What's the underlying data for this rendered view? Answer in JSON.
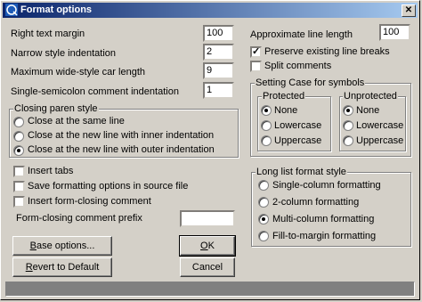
{
  "title": "Format options",
  "fields": {
    "right_text_margin": {
      "label": "Right text margin",
      "value": "100"
    },
    "narrow_indent": {
      "label": "Narrow style indentation",
      "value": "2"
    },
    "max_wide_car": {
      "label": "Maximum wide-style car length",
      "value": "9"
    },
    "semicolon_indent": {
      "label": "Single-semicolon comment indentation",
      "value": "1"
    },
    "approx_line_length": {
      "label": "Approximate line length",
      "value": "100"
    },
    "form_closing_prefix": {
      "label": "Form-closing comment prefix",
      "value": ""
    }
  },
  "checks": {
    "preserve_breaks": {
      "label": "Preserve existing line breaks",
      "checked": true
    },
    "split_comments": {
      "label": "Split comments",
      "checked": false
    },
    "insert_tabs": {
      "label": "Insert tabs",
      "checked": false
    },
    "save_in_source": {
      "label": "Save formatting options in source file",
      "checked": false
    },
    "insert_form_closing": {
      "label": "Insert form-closing comment",
      "checked": false
    }
  },
  "closing_paren": {
    "legend": "Closing paren style",
    "options": [
      "Close at the same line",
      "Close at the new line with inner indentation",
      "Close at the new line with outer indentation"
    ],
    "selected": 2
  },
  "case_group": {
    "legend": "Setting Case for symbols",
    "protected": {
      "legend": "Protected",
      "options": [
        "None",
        "Lowercase",
        "Uppercase"
      ],
      "selected": 0
    },
    "unprotected": {
      "legend": "Unprotected",
      "options": [
        "None",
        "Lowercase",
        "Uppercase"
      ],
      "selected": 0
    }
  },
  "long_list": {
    "legend": "Long list format style",
    "options": [
      "Single-column formatting",
      "2-column formatting",
      "Multi-column formatting",
      "Fill-to-margin formatting"
    ],
    "selected": 2
  },
  "buttons": {
    "base_options": {
      "accel": "B",
      "rest": "ase options..."
    },
    "revert": {
      "accel": "R",
      "rest": "evert to Default"
    },
    "ok": {
      "accel": "O",
      "rest": "K"
    },
    "cancel": "Cancel"
  }
}
